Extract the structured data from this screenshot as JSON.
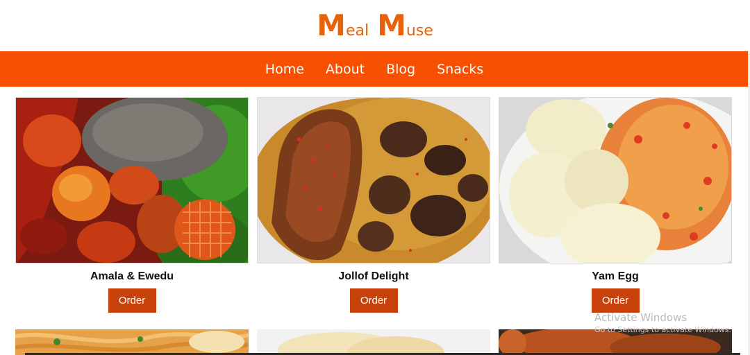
{
  "logo": {
    "m1": "M",
    "w1": "eal",
    "m2": "M",
    "w2": "use"
  },
  "nav": [
    {
      "label": "Home"
    },
    {
      "label": "About"
    },
    {
      "label": "Blog"
    },
    {
      "label": "Snacks"
    }
  ],
  "cards": [
    {
      "name": "Amala & Ewedu",
      "order_label": "Order"
    },
    {
      "name": "Jollof Delight",
      "order_label": "Order"
    },
    {
      "name": "Yam Egg",
      "order_label": "Order"
    }
  ],
  "watermark": {
    "title": "Activate Windows",
    "subtitle": "Go to Settings to activate Windows."
  },
  "colors": {
    "brand": "#e8620c",
    "nav_bg": "#f75000",
    "button": "#c8410b"
  }
}
